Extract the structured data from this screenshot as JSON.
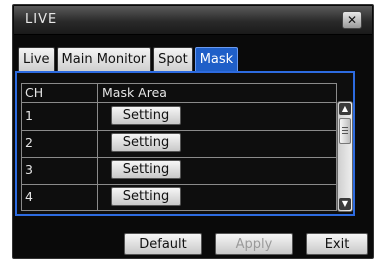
{
  "window": {
    "title": "LIVE",
    "close_label": "✕"
  },
  "tabs": [
    {
      "label": "Live",
      "active": false
    },
    {
      "label": "Main Monitor",
      "active": false
    },
    {
      "label": "Spot",
      "active": false
    },
    {
      "label": "Mask",
      "active": true
    }
  ],
  "table": {
    "columns": [
      "CH",
      "Mask Area"
    ],
    "rows": [
      {
        "ch": "1",
        "button": "Setting"
      },
      {
        "ch": "2",
        "button": "Setting"
      },
      {
        "ch": "3",
        "button": "Setting"
      },
      {
        "ch": "4",
        "button": "Setting"
      }
    ]
  },
  "scrollbar": {
    "up_icon": "triangle-up",
    "down_icon": "triangle-down"
  },
  "footer": {
    "default_label": "Default",
    "apply_label": "Apply",
    "apply_enabled": false,
    "exit_label": "Exit"
  },
  "colors": {
    "accent": "#1f5fc8",
    "panel_border": "#2d6be0",
    "background": "#0a0a0a"
  }
}
